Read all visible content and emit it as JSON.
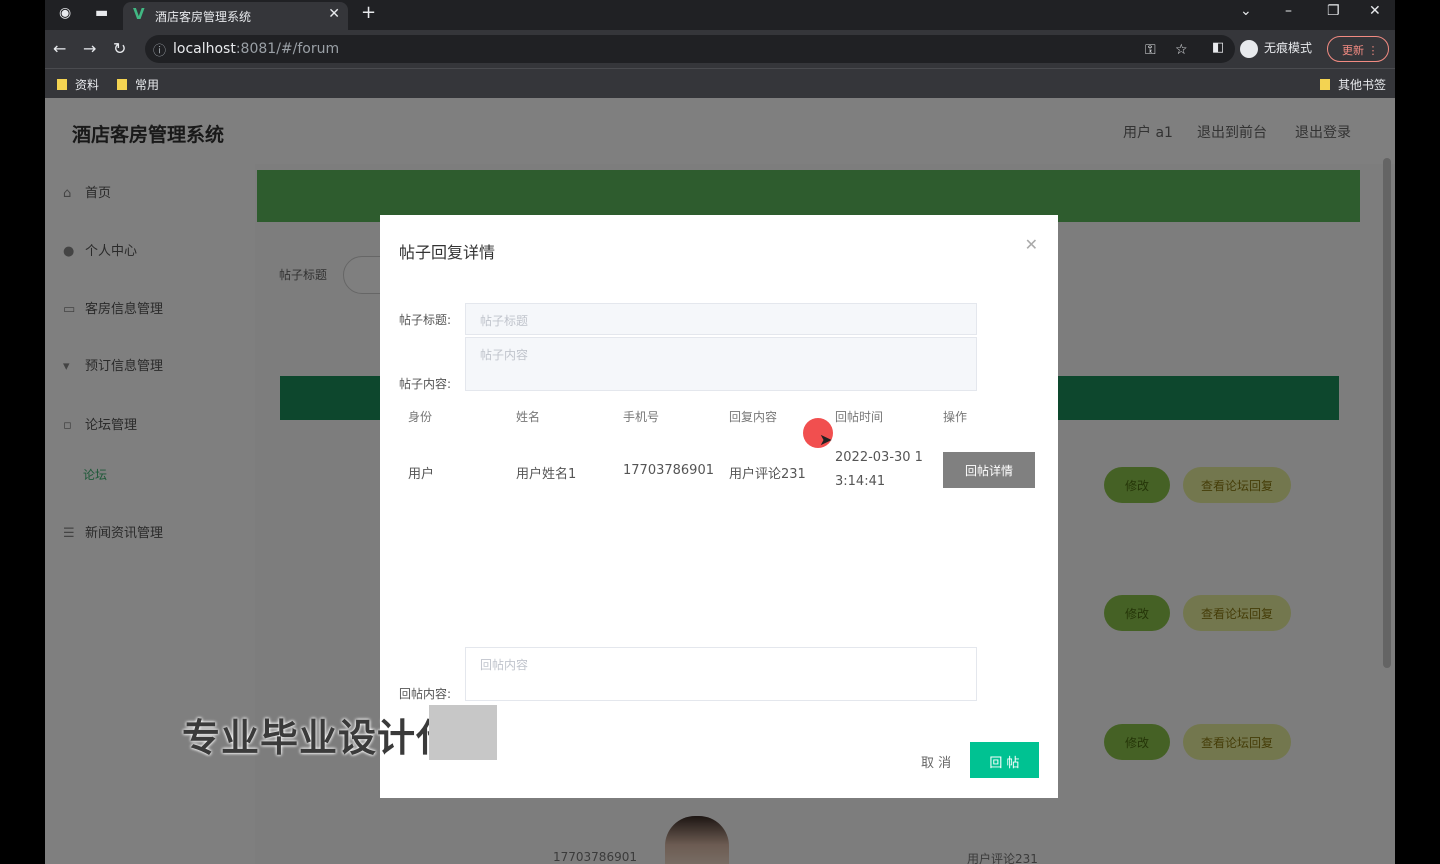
{
  "browser": {
    "tab_title": "酒店客房管理系统",
    "tab_logo": "V",
    "url_host": "localhost",
    "url_path": ":8081/#/forum",
    "incognito_label": "无痕模式",
    "update_label": "更新",
    "bookmarks": [
      "资料",
      "常用"
    ],
    "bookmarks_other": "其他书签"
  },
  "app": {
    "title": "酒店客房管理系统",
    "header_links": [
      "用户 a1",
      "退出到前台",
      "退出登录"
    ],
    "sidebar": [
      {
        "label": "首页",
        "icon": "home-icon"
      },
      {
        "label": "个人中心",
        "icon": "user-icon"
      },
      {
        "label": "客房信息管理",
        "icon": "room-icon"
      },
      {
        "label": "预订信息管理",
        "icon": "booking-icon"
      },
      {
        "label": "论坛管理",
        "icon": "forum-icon"
      },
      {
        "label": "新闻资讯管理",
        "icon": "news-icon"
      }
    ],
    "sidebar_sub": "论坛",
    "search_label": "帖子标题",
    "row_buttons": {
      "edit": "修改",
      "view": "查看论坛回复"
    },
    "bottom_phone": "17703786901",
    "bottom_text2": "用户评论231"
  },
  "modal": {
    "title": "帖子回复详情",
    "post_title_label": "帖子标题:",
    "post_title_placeholder": "帖子标题",
    "post_content_label": "帖子内容:",
    "post_content_placeholder": "帖子内容",
    "table_headers": [
      "身份",
      "姓名",
      "手机号",
      "回复内容",
      "回帖时间",
      "操作"
    ],
    "rows": [
      {
        "role": "用户",
        "name": "用户姓名1",
        "phone": "17703786901",
        "content": "用户评论231",
        "time_line1": "2022-03-30 1",
        "time_line2": "3:14:41",
        "action": "回帖详情"
      }
    ],
    "reply_label": "回帖内容:",
    "reply_placeholder": "回帖内容",
    "cancel_label": "取 消",
    "submit_label": "回 帖"
  },
  "overlay_text": "专业毕业设计代做",
  "colors": {
    "primary_green": "#00c292",
    "table_head": "#1a8f5a",
    "banner": "#5cb85c"
  }
}
